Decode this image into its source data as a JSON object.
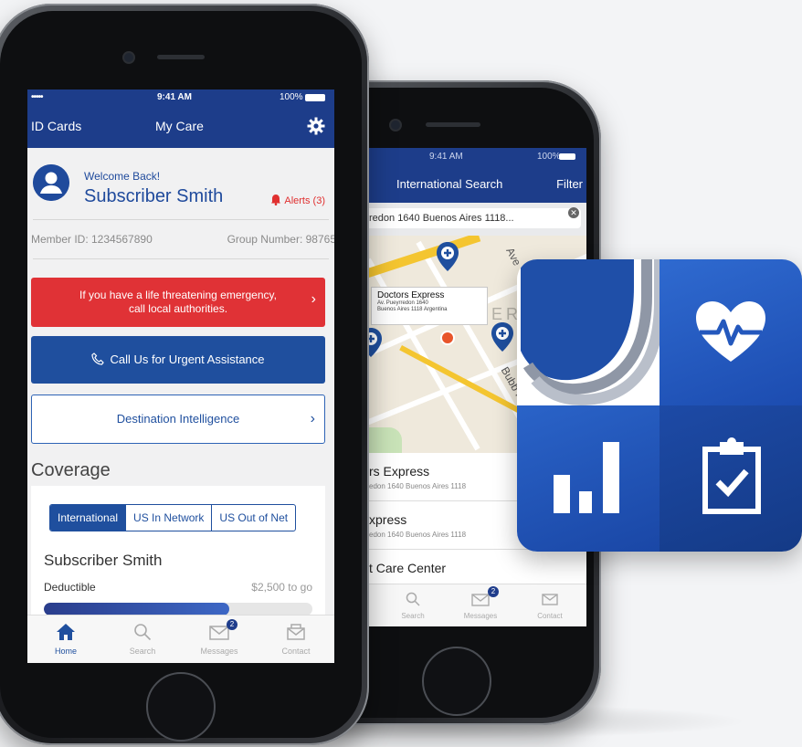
{
  "colors": {
    "brand_blue": "#1d3d8a",
    "emergency_red": "#e03236",
    "button_blue": "#1f4f9e"
  },
  "back_phone": {
    "status": {
      "time": "9:41 AM",
      "battery": "100%"
    },
    "nav": {
      "title": "International Search",
      "filter": "Filter"
    },
    "search": {
      "value": "redon 1640 Buenos Aires 1118..."
    },
    "map": {
      "streets": [
        "Ave",
        "Bubb Rd"
      ],
      "map_text": "ERT",
      "callout": {
        "name": "Doctors Express",
        "line1": "Av. Pueyrredon 1640",
        "line2": "Buenos Aires 1118 Argentina"
      }
    },
    "results": [
      {
        "name": "rs Express",
        "address": "edon 1640 Buenos Aires 1118"
      },
      {
        "name": "xpress",
        "address": "edon 1640 Buenos Aires 1118"
      },
      {
        "name": "t Care Center",
        "address": ""
      }
    ],
    "tabs": [
      {
        "label": "Search",
        "icon": "search-icon"
      },
      {
        "label": "Messages",
        "icon": "envelope-icon",
        "badge": "2"
      },
      {
        "label": "Contact",
        "icon": "contact-icon"
      }
    ]
  },
  "front_phone": {
    "status": {
      "signal": "•••••",
      "time": "9:41 AM",
      "battery": "100%"
    },
    "nav": {
      "left": "ID Cards",
      "title": "My Care",
      "settings_icon": "gear-icon"
    },
    "welcome": {
      "greeting": "Welcome Back!",
      "name": "Subscriber Smith",
      "alerts": "Alerts (3)"
    },
    "ids": {
      "member": "Member ID: 1234567890",
      "group": "Group Number: 98765"
    },
    "buttons": {
      "emergency_line1": "If you have a life threatening emergency,",
      "emergency_line2": "call local authorities.",
      "urgent": "Call Us for Urgent Assistance",
      "destination": "Destination Intelligence"
    },
    "coverage": {
      "heading": "Coverage",
      "segments": [
        "International",
        "US In Network",
        "US Out of Net"
      ],
      "selected_segment": "International",
      "subscriber": "Subscriber Smith",
      "deductible_label": "Deductible",
      "remaining": "$2,500 to go",
      "deductible_progress": 0.69
    },
    "tabs": [
      {
        "label": "Home",
        "icon": "home-icon",
        "active": true
      },
      {
        "label": "Search",
        "icon": "search-icon"
      },
      {
        "label": "Messages",
        "icon": "envelope-icon",
        "badge": "2"
      },
      {
        "label": "Contact",
        "icon": "contact-icon"
      }
    ]
  },
  "app_icon": {
    "icons": [
      "logo-arcs-icon",
      "heart-pulse-icon",
      "bar-chart-icon",
      "clipboard-check-icon"
    ]
  }
}
